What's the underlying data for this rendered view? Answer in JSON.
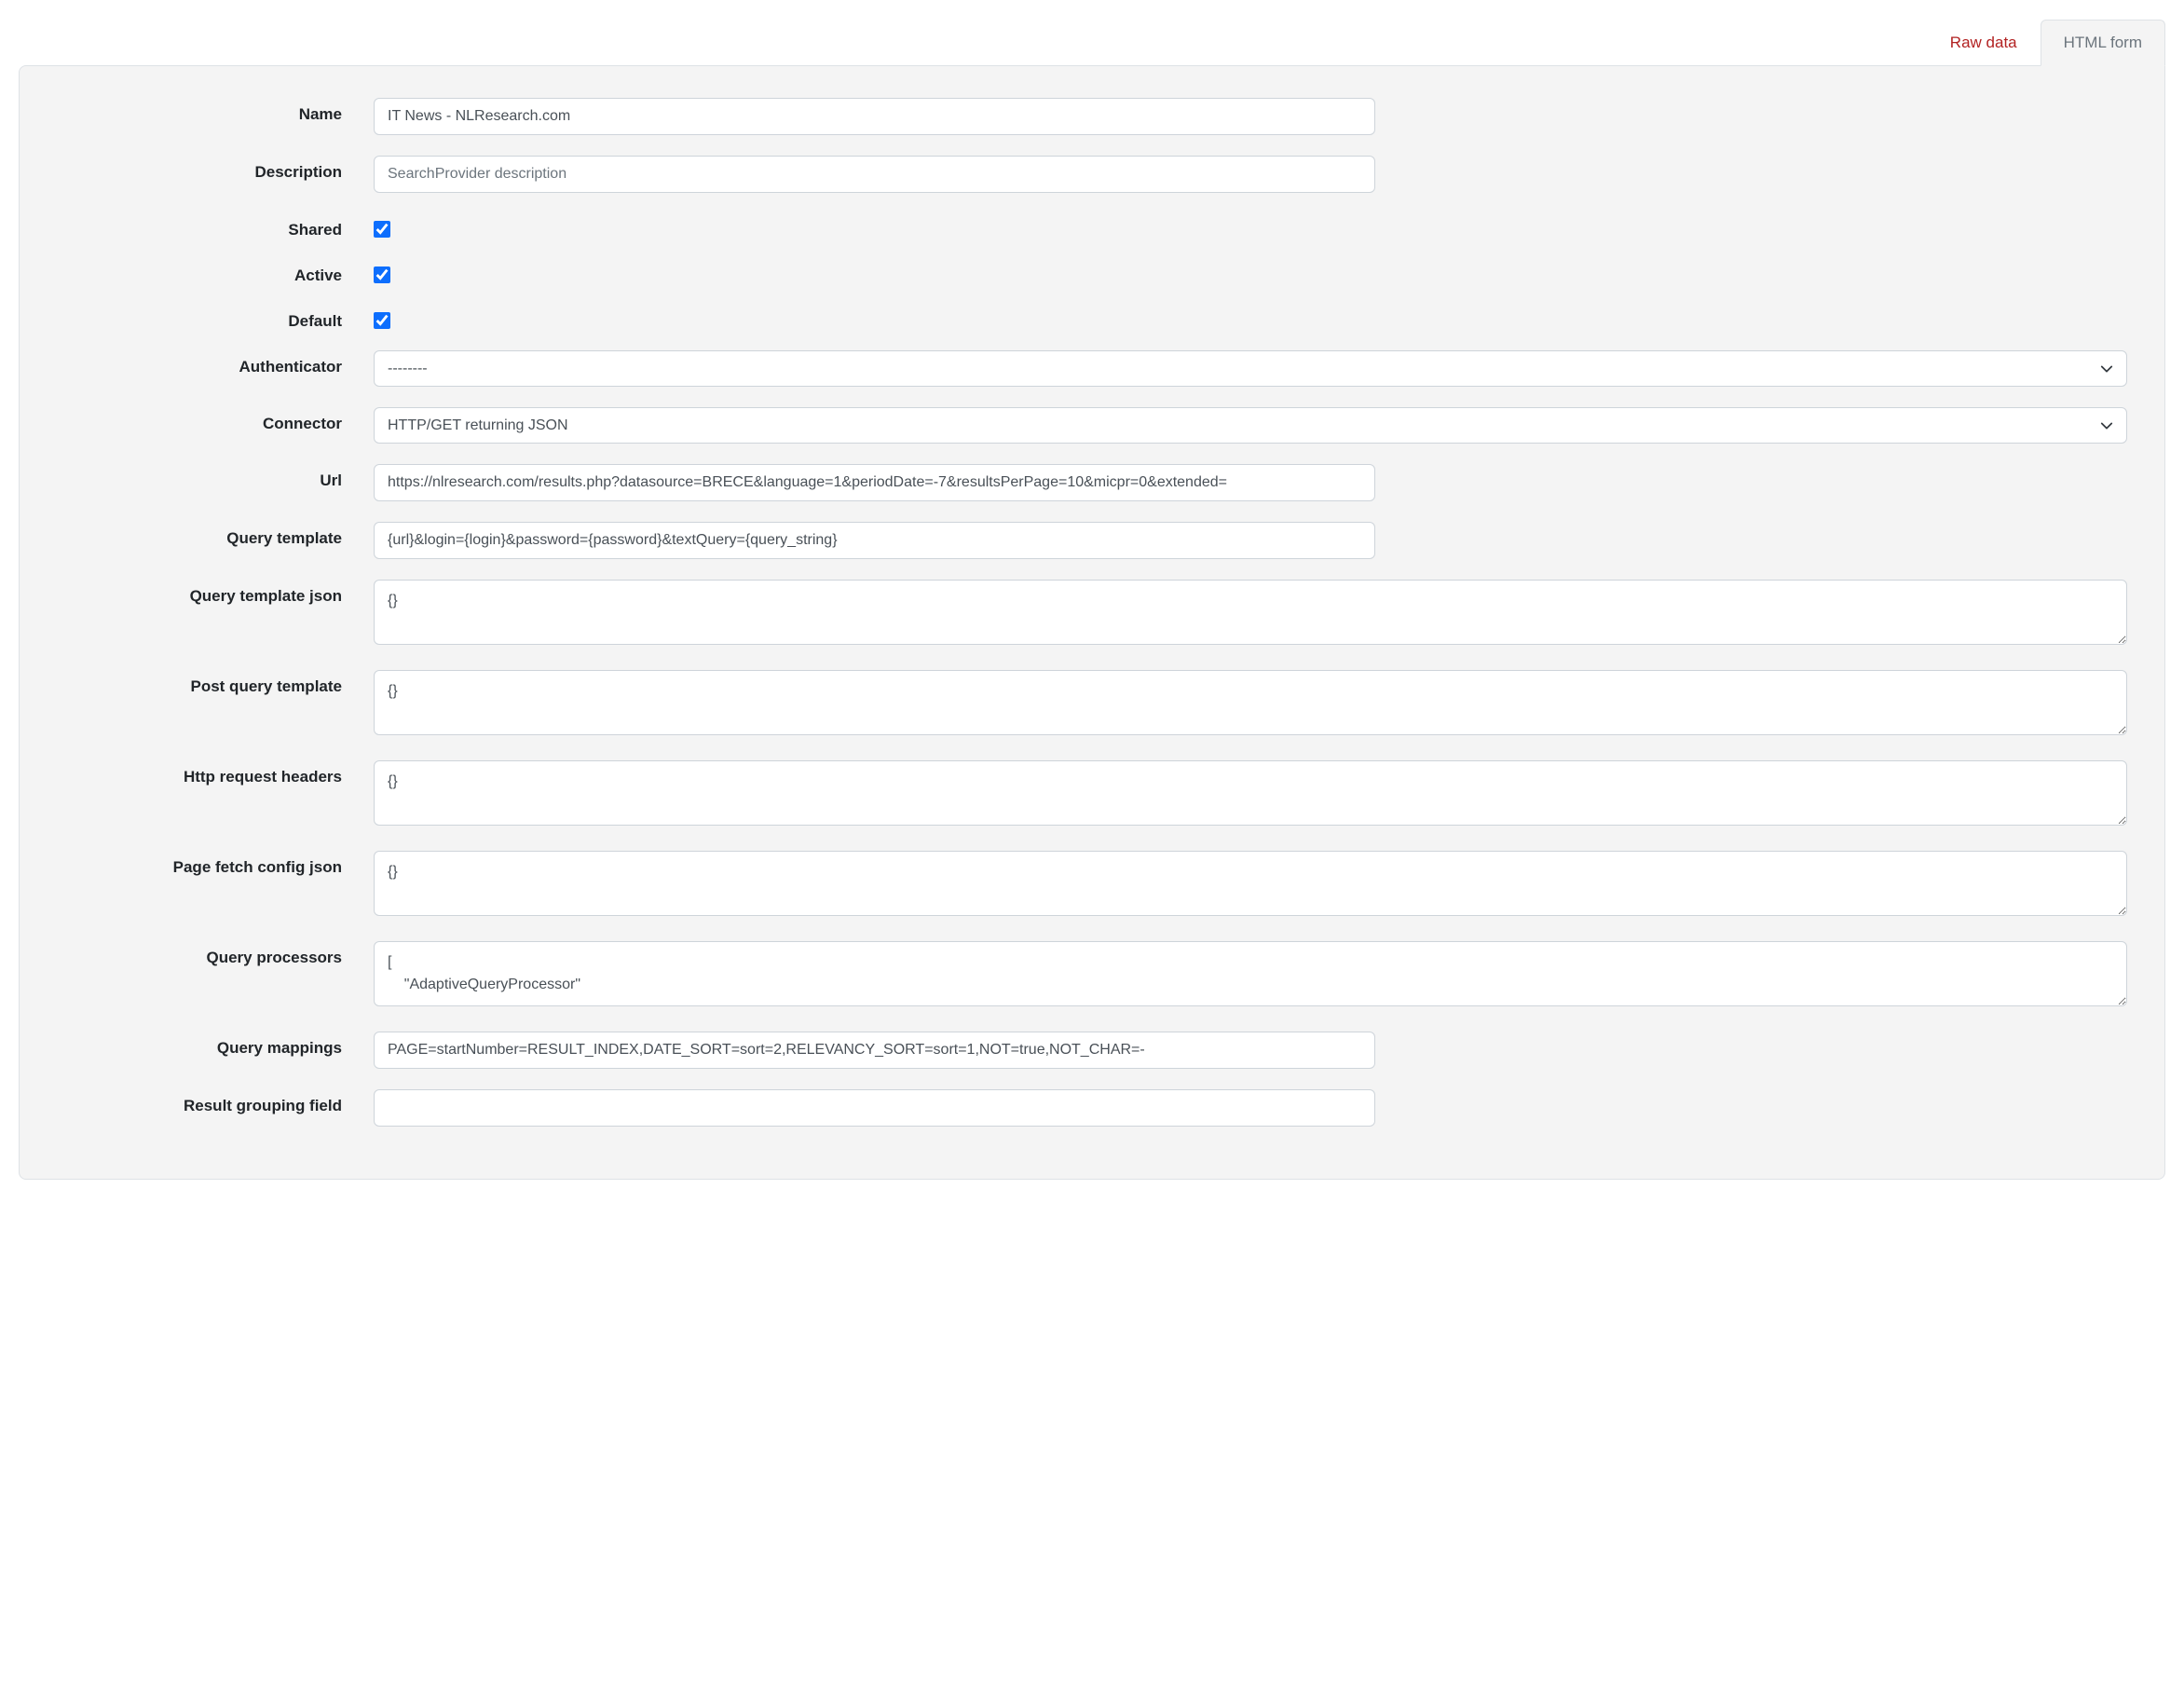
{
  "tabs": {
    "raw_data": "Raw data",
    "html_form": "HTML form"
  },
  "form": {
    "name": {
      "label": "Name",
      "value": "IT News - NLResearch.com"
    },
    "description": {
      "label": "Description",
      "placeholder": "SearchProvider description",
      "value": ""
    },
    "shared": {
      "label": "Shared",
      "checked": true
    },
    "active": {
      "label": "Active",
      "checked": true
    },
    "default": {
      "label": "Default",
      "checked": true
    },
    "authenticator": {
      "label": "Authenticator",
      "value": "--------"
    },
    "connector": {
      "label": "Connector",
      "value": "HTTP/GET returning JSON"
    },
    "url": {
      "label": "Url",
      "value": "https://nlresearch.com/results.php?datasource=BRECE&language=1&periodDate=-7&resultsPerPage=10&micpr=0&extended="
    },
    "query_template": {
      "label": "Query template",
      "value": "{url}&login={login}&password={password}&textQuery={query_string}"
    },
    "query_template_json": {
      "label": "Query template json",
      "value": "{}"
    },
    "post_query_template": {
      "label": "Post query template",
      "value": "{}"
    },
    "http_request_headers": {
      "label": "Http request headers",
      "value": "{}"
    },
    "page_fetch_config_json": {
      "label": "Page fetch config json",
      "value": "{}"
    },
    "query_processors": {
      "label": "Query processors",
      "value": "[\n    \"AdaptiveQueryProcessor\""
    },
    "query_mappings": {
      "label": "Query mappings",
      "value": "PAGE=startNumber=RESULT_INDEX,DATE_SORT=sort=2,RELEVANCY_SORT=sort=1,NOT=true,NOT_CHAR=-"
    },
    "result_grouping_field": {
      "label": "Result grouping field",
      "value": ""
    }
  }
}
